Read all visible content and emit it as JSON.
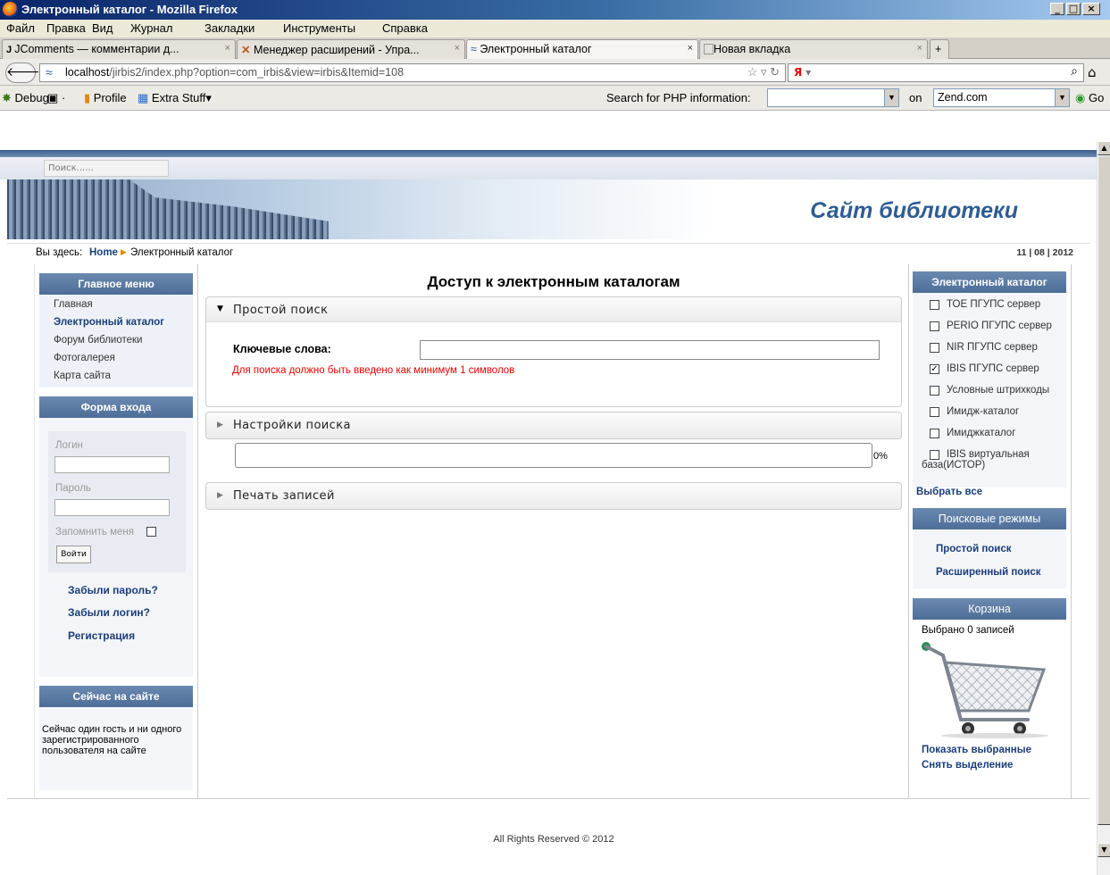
{
  "window": {
    "title": "Электронный каталог - Mozilla Firefox"
  },
  "menu": [
    "Файл",
    "Правка",
    "Вид",
    "Журнал",
    "Закладки",
    "Инструменты",
    "Справка"
  ],
  "tabs": [
    {
      "label": "JComments — комментарии д..."
    },
    {
      "label": "Менеджер расширений - Упра..."
    },
    {
      "label": "Электронный каталог"
    },
    {
      "label": "Новая вкладка"
    }
  ],
  "nav": {
    "url_host": "localhost",
    "url_rest": "/jirbis2/index.php?option=com_irbis&view=irbis&Itemid=108",
    "search_engine": "Я"
  },
  "debugbar": {
    "debug": "Debug",
    "profile": "Profile",
    "extra": "Extra Stuff",
    "php_label": "Search for PHP information:",
    "on": "on",
    "site": "Zend.com",
    "go": "Go"
  },
  "site": {
    "search_placeholder": "Поиск......",
    "title": "Сайт библиотеки",
    "crumb_prefix": "Вы здесь:",
    "crumb_home": "Home",
    "crumb_current": "Электронный каталог",
    "date": "11 | 08 | 2012",
    "footer": "All Rights Reserved © 2012"
  },
  "left": {
    "main_menu_title": "Главное меню",
    "main_menu": [
      "Главная",
      "Электронный каталог",
      "Форум библиотеки",
      "Фотогалерея",
      "Карта сайта"
    ],
    "login_title": "Форма входа",
    "login_label": "Логин",
    "password_label": "Пароль",
    "remember": "Запомнить меня",
    "login_button": "Войти",
    "links": [
      "Забыли пароль?",
      "Забыли логин?",
      "Регистрация"
    ],
    "online_title": "Сейчас на сайте",
    "online_text": "Сейчас один гость и ни одного зарегистрированного пользователя на сайте"
  },
  "main": {
    "heading": "Доступ к электронным каталогам",
    "simple_search": "Простой поиск",
    "keywords_label": "Ключевые слова:",
    "keywords_value": "",
    "error": "Для поиска должно быть введено как минимум 1 символов",
    "settings": "Настройки поиска",
    "progress_percent": "0%",
    "progress_value": 0,
    "print": "Печать записей"
  },
  "right": {
    "catalog_title": "Электронный каталог",
    "catalogs": [
      {
        "label": "ТОЕ ПГУПС сервер",
        "checked": false
      },
      {
        "label": "PERIO ПГУПС сервер",
        "checked": false
      },
      {
        "label": "NIR ПГУПС сервер",
        "checked": false
      },
      {
        "label": "IBIS ПГУПС сервер",
        "checked": true
      },
      {
        "label": "Условные штрихкоды",
        "checked": false
      },
      {
        "label": "Имидж-каталог",
        "checked": false
      },
      {
        "label": "Имиджкаталог",
        "checked": false
      },
      {
        "label": "IBIS виртуальная база(ИСТОР)",
        "checked": false
      }
    ],
    "select_all": "Выбрать все",
    "modes_title": "Поисковые режимы",
    "modes": [
      "Простой поиск",
      "Расширенный поиск"
    ],
    "cart_title": "Корзина",
    "cart_count": "Выбрано 0 записей",
    "show_selected": "Показать выбранные",
    "clear_selection": "Снять выделение"
  }
}
